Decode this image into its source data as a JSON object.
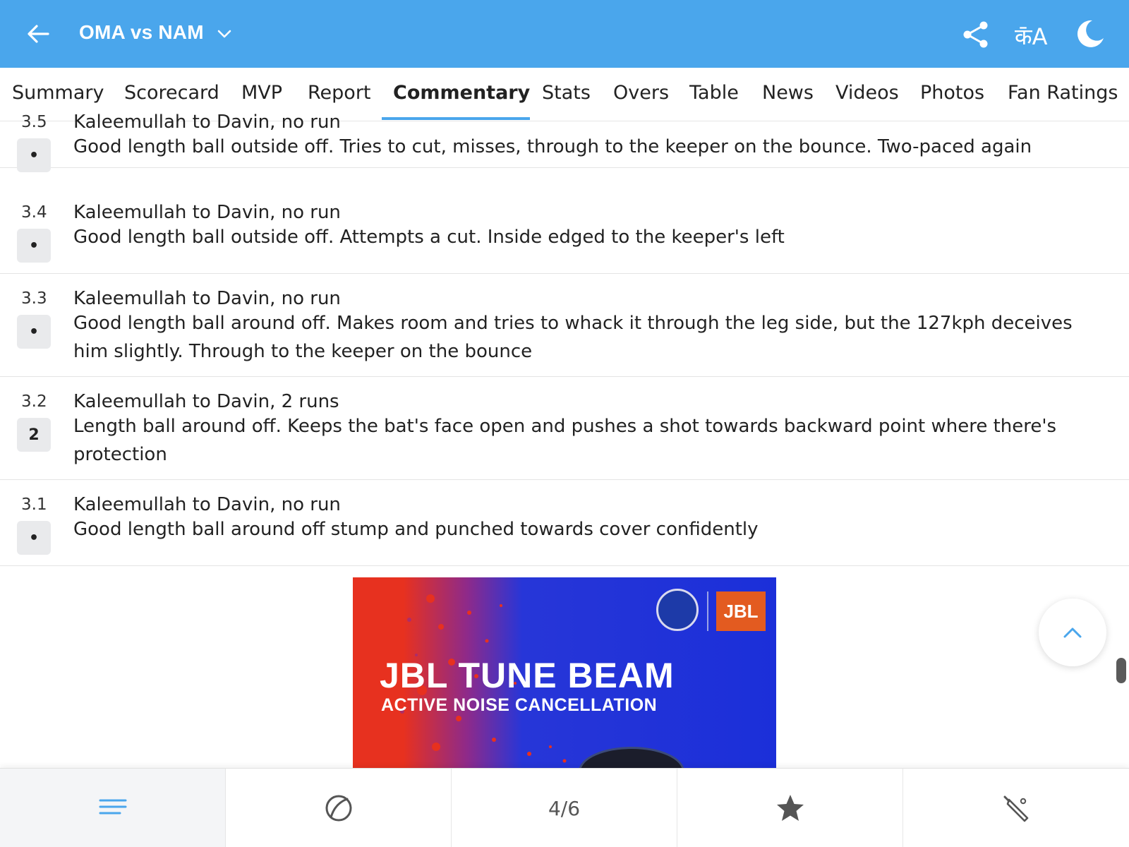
{
  "header": {
    "title": "OMA vs NAM",
    "lang_label": "क̄A",
    "colors": {
      "bar": "#4aa6ec",
      "accent": "#4aa6ec"
    },
    "icons": [
      "back-arrow-icon",
      "chevron-down-icon",
      "share-icon",
      "language-icon",
      "dark-mode-moon-icon"
    ]
  },
  "tabs": [
    {
      "label": "Summary"
    },
    {
      "label": "Scorecard"
    },
    {
      "label": "MVP"
    },
    {
      "label": "Report"
    },
    {
      "label": "Commentary",
      "active": true
    },
    {
      "label": "Stats"
    },
    {
      "label": "Overs"
    },
    {
      "label": "Table"
    },
    {
      "label": "News"
    },
    {
      "label": "Videos"
    },
    {
      "label": "Photos"
    },
    {
      "label": "Fan Ratings"
    }
  ],
  "commentary": [
    {
      "over": "3.5",
      "ball": "•",
      "headline": "Kaleemullah to Davin, no run",
      "desc": "Good length ball outside off. Tries to cut, misses, through to the keeper on the bounce. Two-paced again"
    },
    {
      "over": "3.4",
      "ball": "•",
      "headline": "Kaleemullah to Davin, no run",
      "desc": "Good length ball outside off. Attempts a cut. Inside edged to the keeper's left"
    },
    {
      "over": "3.3",
      "ball": "•",
      "headline": "Kaleemullah to Davin, no run",
      "desc": "Good length ball around off. Makes room and tries to whack it through the leg side, but the 127kph deceives him slightly. Through to the keeper on the bounce"
    },
    {
      "over": "3.2",
      "ball": "2",
      "headline": "Kaleemullah to Davin, 2 runs",
      "desc": "Length ball around off. Keeps the bat's face open and pushes a shot towards backward point where there's protection"
    },
    {
      "over": "3.1",
      "ball": "•",
      "headline": "Kaleemullah to Davin, no run",
      "desc": "Good length ball around off stump and punched towards cover confidently"
    }
  ],
  "ad": {
    "headline": "JBL TUNE BEAM",
    "subline": "ACTIVE NOISE CANCELLATION",
    "brand": "JBL"
  },
  "bottom_nav": {
    "page_indicator": "4/6",
    "icons": [
      "menu-lines-icon",
      "ball-icon",
      "star-icon",
      "cricket-bat-icon"
    ]
  }
}
